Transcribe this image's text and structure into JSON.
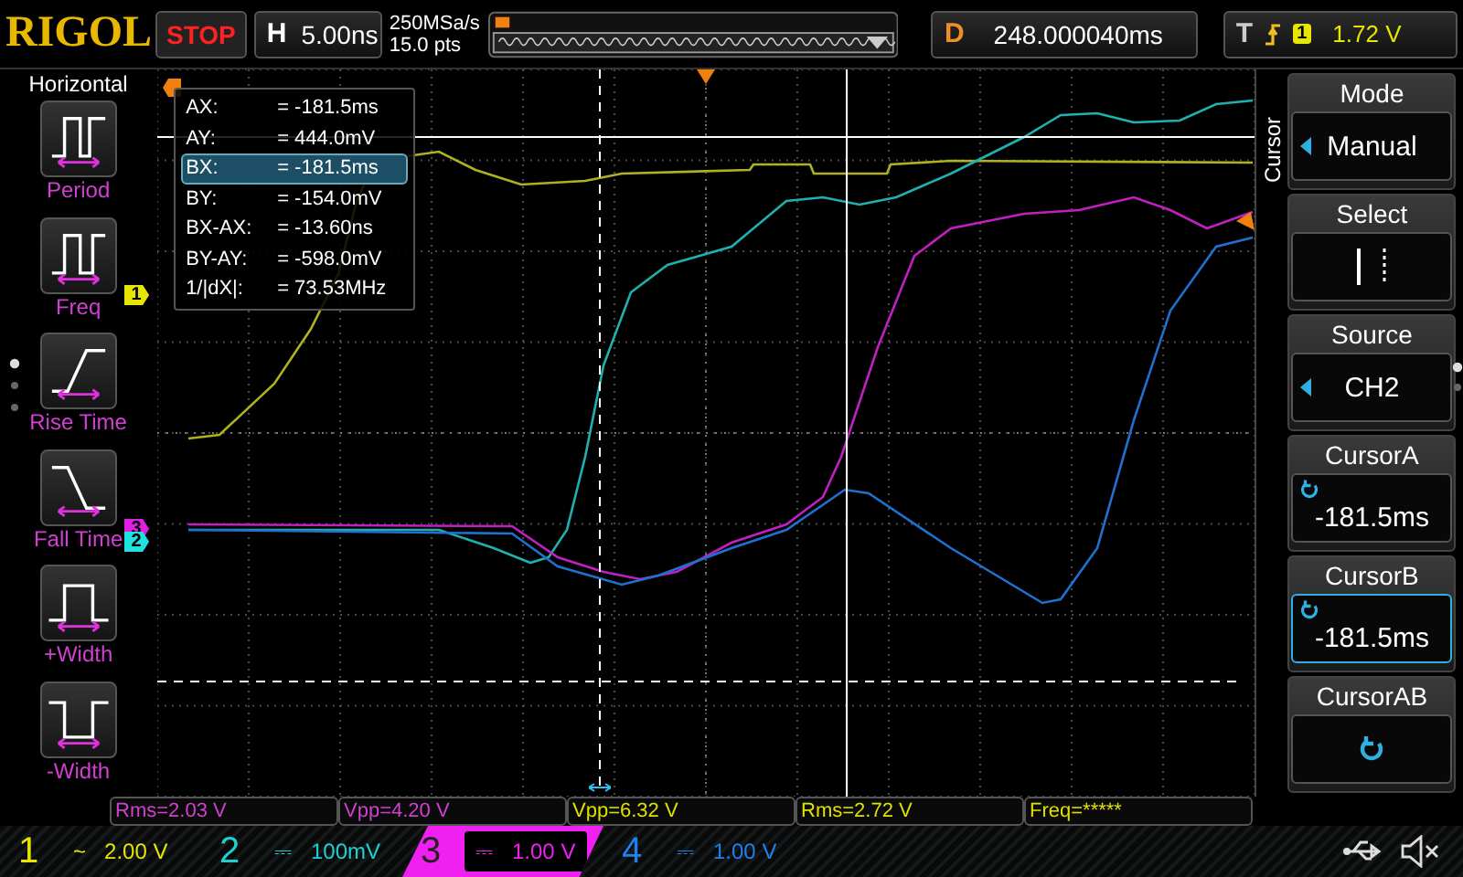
{
  "top_bar": {
    "logo": "RIGOL",
    "run_state": "STOP",
    "timebase": {
      "label": "H",
      "value": "5.00ns"
    },
    "sample_rate": "250MSa/s",
    "memory_depth": "15.0 pts",
    "delay": {
      "label": "D",
      "value": "248.000040ms"
    },
    "trigger": {
      "label": "T",
      "source": "1",
      "level": "1.72 V"
    }
  },
  "left_menu": {
    "title": "Horizontal",
    "items": [
      {
        "label": "Period",
        "kind": "period"
      },
      {
        "label": "Freq",
        "kind": "freq"
      },
      {
        "label": "Rise Time",
        "kind": "rise"
      },
      {
        "label": "Fall Time",
        "kind": "fall"
      },
      {
        "label": "+Width",
        "kind": "pwidth"
      },
      {
        "label": "-Width",
        "kind": "nwidth"
      }
    ]
  },
  "cursor_readout": [
    {
      "name": "AX:",
      "value": "= -181.5ms",
      "selected": false
    },
    {
      "name": "AY:",
      "value": "= 444.0mV",
      "selected": false
    },
    {
      "name": "BX:",
      "value": "= -181.5ms",
      "selected": true
    },
    {
      "name": "BY:",
      "value": "= -154.0mV",
      "selected": false
    },
    {
      "name": "BX-AX:",
      "value": "= -13.60ns",
      "selected": false
    },
    {
      "name": "BY-AY:",
      "value": "= -598.0mV",
      "selected": false
    },
    {
      "name": "1/|dX|:",
      "value": "= 73.53MHz",
      "selected": false
    }
  ],
  "channel_markers": [
    {
      "label": "1",
      "color": "#e6e600"
    },
    {
      "label": "3",
      "color": "#e020e0"
    },
    {
      "label": "2",
      "color": "#20e0e0"
    }
  ],
  "right_menu": {
    "title": "Cursor",
    "items": [
      {
        "label": "Mode",
        "kind": "option",
        "value": "Manual",
        "selected": false
      },
      {
        "label": "Select",
        "kind": "select",
        "selected": false
      },
      {
        "label": "Source",
        "kind": "option",
        "value": "CH2",
        "selected": false
      },
      {
        "label": "CursorA",
        "kind": "knob",
        "value": "-181.5ms",
        "selected": false
      },
      {
        "label": "CursorB",
        "kind": "knob",
        "value": "-181.5ms",
        "selected": true
      },
      {
        "label": "CursorAB",
        "kind": "knob",
        "selected": false
      }
    ]
  },
  "measurements": [
    {
      "text": "Rms=2.03 V",
      "color": "#d040d0"
    },
    {
      "text": "Vpp=4.20 V",
      "color": "#d040d0"
    },
    {
      "text": "Vpp=6.32 V",
      "color": "#e0e000"
    },
    {
      "text": "Rms=2.72 V",
      "color": "#e0e000"
    },
    {
      "text": "Freq=*****",
      "color": "#e0e000"
    }
  ],
  "channels": [
    {
      "number": "1",
      "coupling": "~",
      "scale": "2.00 V",
      "color": "#e6e600",
      "selected": false
    },
    {
      "number": "2",
      "coupling": "⎓",
      "scale": "100mV",
      "color": "#20d0d0",
      "selected": false
    },
    {
      "number": "3",
      "coupling": "⎓",
      "scale": "1.00 V",
      "color": "#f020f0",
      "selected": true
    },
    {
      "number": "4",
      "coupling": "⎓",
      "scale": "1.00 V",
      "color": "#2080f0",
      "selected": false
    }
  ]
}
